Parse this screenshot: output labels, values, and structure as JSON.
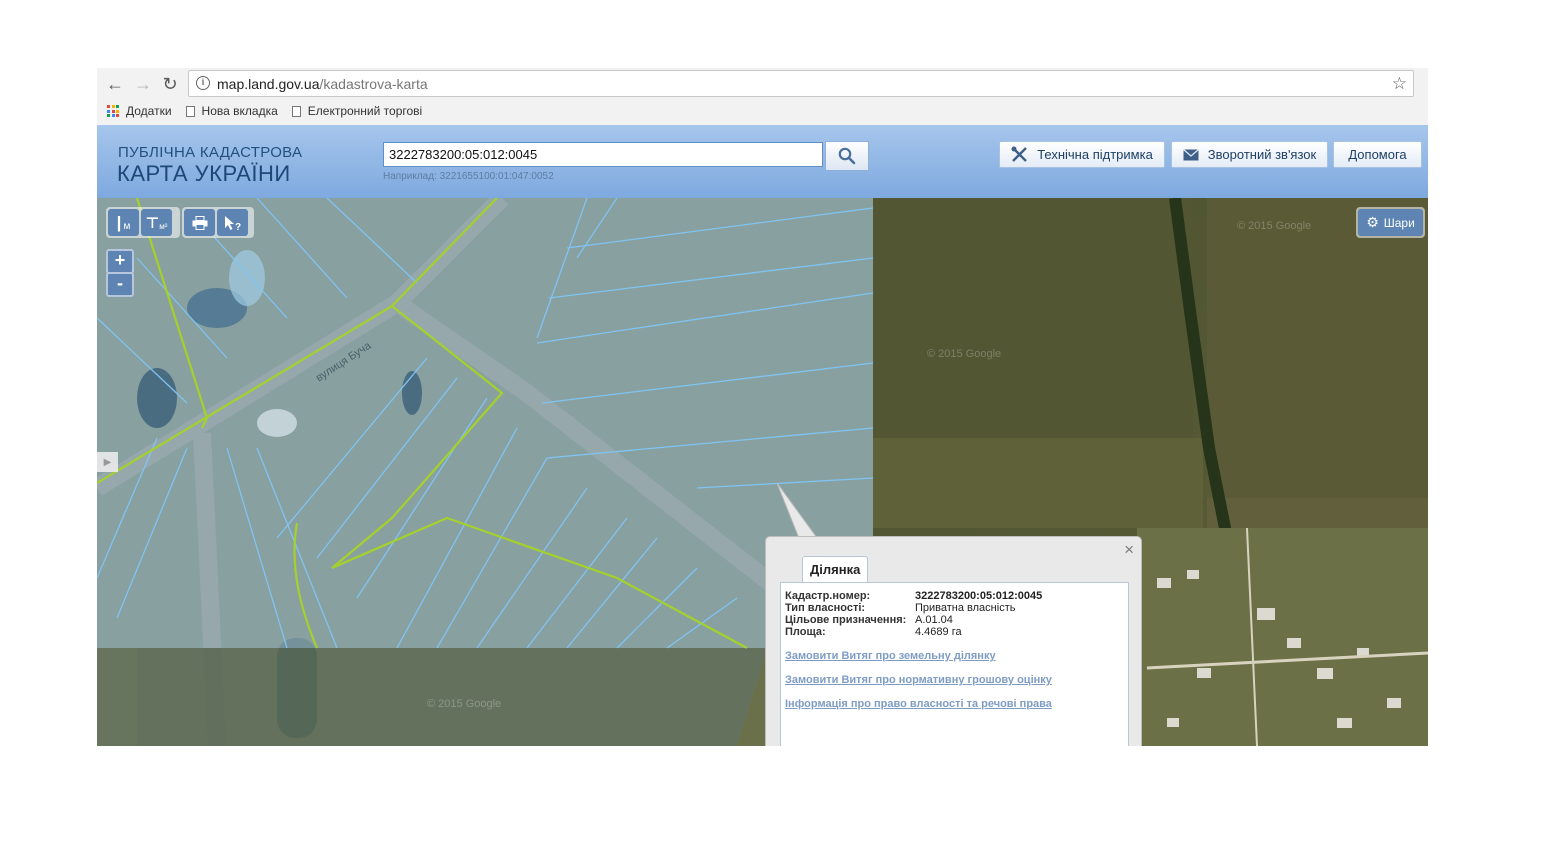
{
  "browser": {
    "url_host": "map.land.gov.ua",
    "url_path": "/kadastrova-karta",
    "bookmarks": [
      "Додатки",
      "Нова вкладка",
      "Електронний торгові"
    ]
  },
  "header": {
    "logo_line1": "ПУБЛІЧНА КАДАСТРОВА",
    "logo_line2": "КАРТА УКРАЇНИ",
    "search_value": "3222783200:05:012:0045",
    "search_hint": "Наприклад: 3221655100:01:047:0052",
    "support_label": "Технічна підтримка",
    "feedback_label": "Зворотний зв'язок",
    "help_label": "Допомога"
  },
  "map": {
    "tool_distance_unit": "м",
    "tool_area_unit": "м²",
    "zoom_in": "+",
    "zoom_out": "-",
    "layers_label": "Шари",
    "road_label": "вулиця Буча",
    "watermark": "© 2015 Google"
  },
  "popup": {
    "tab_label": "Ділянка",
    "close": "×",
    "fields": [
      {
        "label": "Кадастр.номер:",
        "value": "3222783200:05:012:0045"
      },
      {
        "label": "Тип власності:",
        "value": "Приватна власність"
      },
      {
        "label": "Цільове призначення:",
        "value": "A.01.04"
      },
      {
        "label": "Площа:",
        "value": "4.4689 га"
      }
    ],
    "links": [
      "Замовити Витяг про земельну ділянку",
      "Замовити Витяг про нормативну грошову оцінку",
      "Інформація про право власності та речові права"
    ]
  },
  "colors": {
    "header_blue": "#7ea9df",
    "parcel_fill": "#b9dbf6",
    "parcel_stroke": "#7fc4f3",
    "boundary_green": "#a4d12c"
  }
}
